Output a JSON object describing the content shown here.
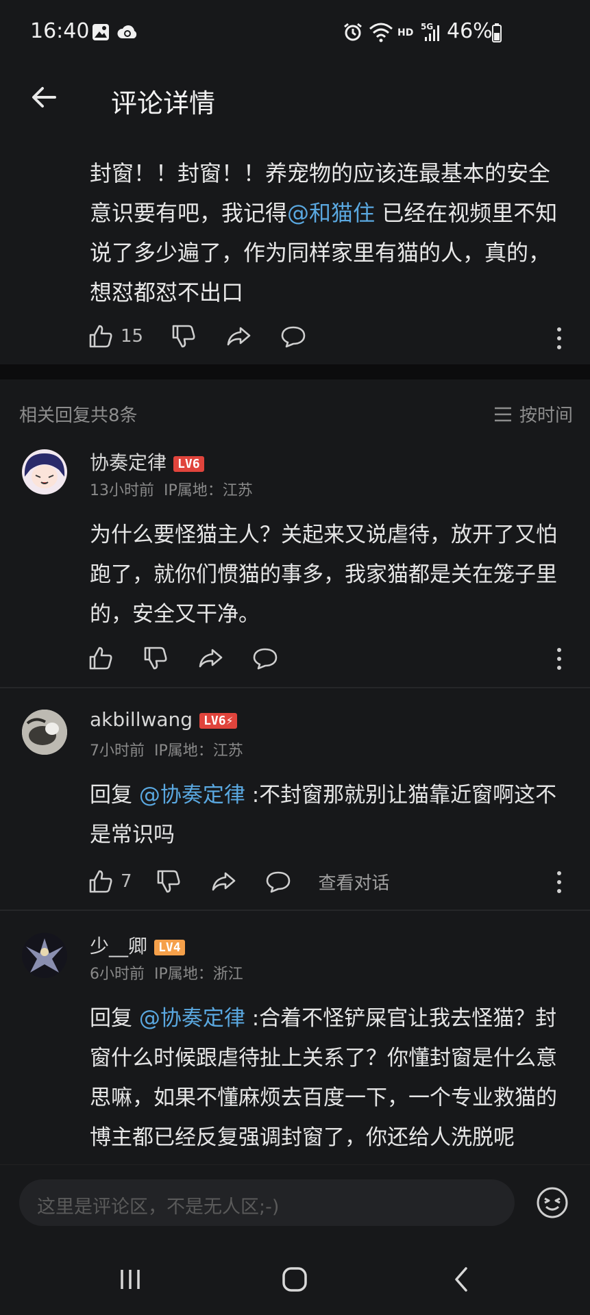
{
  "status_bar": {
    "time": "16:40",
    "network": "HD",
    "signal": "5G",
    "battery": "46%"
  },
  "header": {
    "title": "评论详情"
  },
  "main_comment": {
    "text_before": "封窗！！封窗！！养宠物的应该连最基本的安全意识要有吧，我记得",
    "mention": "@和猫住",
    "text_after": " 已经在视频里不知说了多少遍了，作为同样家里有猫的人，真的，想怼都怼不出口",
    "likes": "15"
  },
  "replies_header": {
    "count_label": "相关回复共8条",
    "sort_label": "按时间"
  },
  "replies": [
    {
      "username": "协奏定律",
      "level": "LV6",
      "time": "13小时前",
      "ip": "IP属地：江苏",
      "prefix": "",
      "mention": "",
      "text": "为什么要怪猫主人？关起来又说虐待，放开了又怕跑了，就你们惯猫的事多，我家猫都是关在笼子里的，安全又干净。",
      "likes": ""
    },
    {
      "username": "akbillwang",
      "level": "LV6⚡",
      "time": "7小时前",
      "ip": "IP属地：江苏",
      "prefix": "回复 ",
      "mention": "@协奏定律",
      "text": " :不封窗那就别让猫靠近窗啊这不是常识吗",
      "likes": "7",
      "view_conversation": "查看对话"
    },
    {
      "username": "少__卿",
      "level": "LV4",
      "time": "6小时前",
      "ip": "IP属地：浙江",
      "prefix": "回复 ",
      "mention": "@协奏定律",
      "text": " :合着不怪铲屎官让我去怪猫？封窗什么时候跟虐待扯上关系了？你懂封窗是什么意思嘛，如果不懂麻烦去百度一下，一个专业救猫的博主都已经反复强调封窗了，你还给人洗脱呢"
    }
  ],
  "input": {
    "placeholder": "这里是评论区，不是无人区;-)"
  },
  "colors": {
    "background": "#17181a",
    "mention": "#5aa8e0",
    "lv6": "#e0443c",
    "lv4": "#f5a04a"
  },
  "icons": [
    "back-arrow-icon",
    "thumb-up-icon",
    "thumb-down-icon",
    "share-icon",
    "comment-icon",
    "more-vertical-icon",
    "list-icon",
    "emoji-icon"
  ]
}
